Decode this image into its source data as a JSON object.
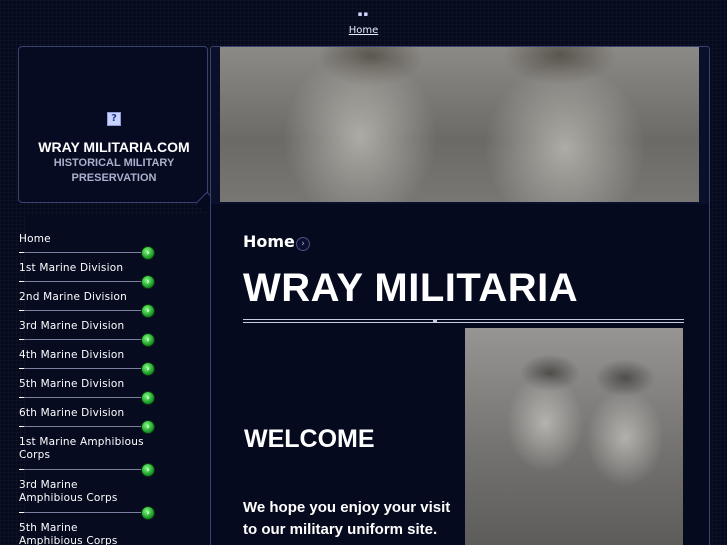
{
  "top_nav": {
    "link": "Home"
  },
  "logo": {
    "site_name": "WRAY MILITARIA.COM",
    "tagline": "HISTORICAL MILITARY PRESERVATION",
    "image_icon": "broken-image-icon"
  },
  "sidebar": {
    "items": [
      {
        "label": "Home"
      },
      {
        "label": "1st Marine Division"
      },
      {
        "label": "2nd Marine Division"
      },
      {
        "label": "3rd Marine Division"
      },
      {
        "label": "4th Marine Division"
      },
      {
        "label": "5th Marine Division"
      },
      {
        "label": "6th Marine Division"
      },
      {
        "label": "1st Marine Amphibious Corps"
      },
      {
        "label": "3rd Marine Amphibious Corps"
      },
      {
        "label": "5th Marine Amphibious Corps"
      }
    ],
    "arrow_icon": "green-arrow-icon",
    "arrow_color": "#2fb83c"
  },
  "content": {
    "breadcrumb": "Home",
    "page_title": "WRAY MILITARIA",
    "welcome": "WELCOME",
    "intro": "We hope you enjoy your visit to our military uniform site."
  },
  "colors": {
    "background": "#060a1e",
    "border": "#3a4270",
    "text": "#ffffff"
  }
}
